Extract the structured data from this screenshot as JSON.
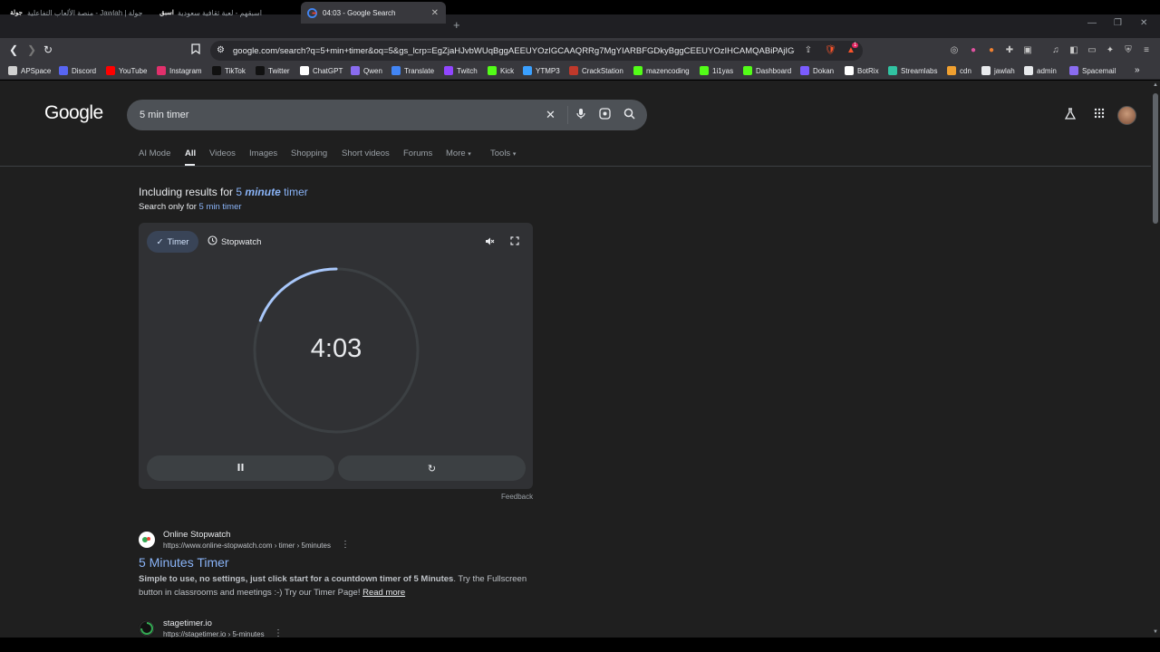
{
  "browser": {
    "tabs": [
      {
        "label": "جولة | Jawlah - منصة الألعاب التفاعلية",
        "icon": "jawlah-icon"
      },
      {
        "label": "اسبقهم - لعبة ثقافية سعودية",
        "icon": "isbiqhum-icon"
      },
      {
        "label": "04:03 - Google Search",
        "icon": "google-icon",
        "active": true
      }
    ],
    "new_tab": "+",
    "url": "google.com/search?q=5+min+timer&oq=5&gs_lcrp=EgZjaHJvbWUqBggAEEUYOzIGCAAQRRg7MgYIARBFGDkyBggCEEUYOzIHCAMQABiPAjIGCAQQ...",
    "extension_badge": "1",
    "bookmarks": [
      {
        "label": "APSpace",
        "color": "#d0d0d0"
      },
      {
        "label": "Discord",
        "color": "#5865f2"
      },
      {
        "label": "YouTube",
        "color": "#ff0000"
      },
      {
        "label": "Instagram",
        "color": "#e1306c"
      },
      {
        "label": "TikTok",
        "color": "#111111"
      },
      {
        "label": "Twitter",
        "color": "#111111"
      },
      {
        "label": "ChatGPT",
        "color": "#ffffff"
      },
      {
        "label": "Qwen",
        "color": "#8a6cf0"
      },
      {
        "label": "Translate",
        "color": "#4285f4"
      },
      {
        "label": "Twitch",
        "color": "#9146ff"
      },
      {
        "label": "Kick",
        "color": "#53fc18"
      },
      {
        "label": "YTMP3",
        "color": "#3aa0ff"
      },
      {
        "label": "CrackStation",
        "color": "#c0392b"
      },
      {
        "label": "mazencoding",
        "color": "#53fc18"
      },
      {
        "label": "1i1yas",
        "color": "#53fc18"
      },
      {
        "label": "Dashboard",
        "color": "#53fc18"
      },
      {
        "label": "Dokan",
        "color": "#7b5cff"
      },
      {
        "label": "BotRix",
        "color": "#ffffff"
      },
      {
        "label": "Streamlabs",
        "color": "#31c3a2"
      },
      {
        "label": "cdn",
        "color": "#f0a030"
      },
      {
        "label": "jawlah",
        "color": "#e8eaed"
      },
      {
        "label": "admin",
        "color": "#e8eaed"
      },
      {
        "label": "Spacemail",
        "color": "#8a6cf0"
      }
    ],
    "bookmarks_more": "»"
  },
  "google": {
    "logo": "Google",
    "query": "5 min timer",
    "nav_tabs": [
      "AI Mode",
      "All",
      "Videos",
      "Images",
      "Shopping",
      "Short videos",
      "Forums",
      "More",
      "Tools"
    ],
    "active_tab": "All",
    "including_prefix": "Including results for ",
    "including_num": "5 ",
    "including_bold": "minute",
    "including_rest": " timer",
    "search_only_prefix": "Search only for ",
    "search_only_link": "5 min timer"
  },
  "timer": {
    "tab_timer": "Timer",
    "tab_stopwatch": "Stopwatch",
    "time": "4:03",
    "remaining_fraction": 0.19,
    "feedback": "Feedback"
  },
  "results": [
    {
      "site": "Online Stopwatch",
      "crumb": "https://www.online-stopwatch.com › timer › 5minutes",
      "title": "5 Minutes Timer",
      "snippet_bold": "Simple to use, no settings, just click start for a countdown timer of 5 Minutes",
      "snippet_rest": ". Try the Fullscreen button in classrooms and meetings :-) Try our Timer Page!",
      "read_more": "Read more"
    },
    {
      "site": "stagetimer.io",
      "crumb": "https://stagetimer.io › 5-minutes"
    }
  ],
  "colors": {
    "page_bg": "#1f1f1f",
    "card_bg": "#303134",
    "link": "#8ab4f8",
    "ring_progress": "#a8c7fa"
  }
}
